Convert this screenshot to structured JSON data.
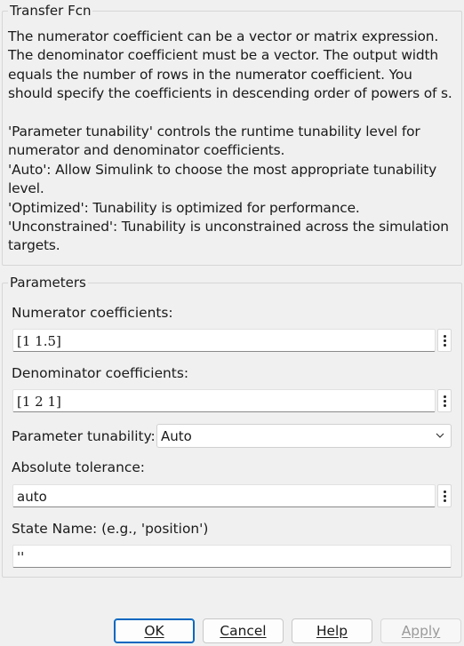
{
  "description_panel": {
    "title": "Transfer Fcn",
    "paragraphs": [
      "The numerator coefficient can be a vector or matrix expression. The denominator coefficient must be a vector. The output width equals the number of rows in the numerator coefficient. You should specify the coefficients in descending order of powers of s.",
      "'Parameter tunability' controls the runtime tunability level for numerator and denominator coefficients.\n'Auto': Allow Simulink to choose the most appropriate tunability level.\n'Optimized': Tunability is optimized for performance.\n'Unconstrained': Tunability is unconstrained across the simulation targets."
    ]
  },
  "parameters_panel": {
    "title": "Parameters",
    "numerator": {
      "label": "Numerator coefficients:",
      "value": "[1 1.5]"
    },
    "denominator": {
      "label": "Denominator coefficients:",
      "value": "[1 2 1]"
    },
    "tunability": {
      "label": "Parameter tunability:",
      "selected": "Auto"
    },
    "abs_tol": {
      "label": "Absolute tolerance:",
      "value": "auto"
    },
    "state_name": {
      "label": "State Name: (e.g., 'position')",
      "value": "''"
    }
  },
  "buttons": {
    "ok": "OK",
    "cancel": "Cancel",
    "help": "Help",
    "apply": "Apply"
  },
  "icons": {
    "field_menu": "vertical-ellipsis-icon",
    "dropdown": "chevron-down-icon"
  },
  "colors": {
    "background": "#f0f0f0",
    "primary_button_border": "#0067c0",
    "disabled_text": "#9a9a9a"
  }
}
